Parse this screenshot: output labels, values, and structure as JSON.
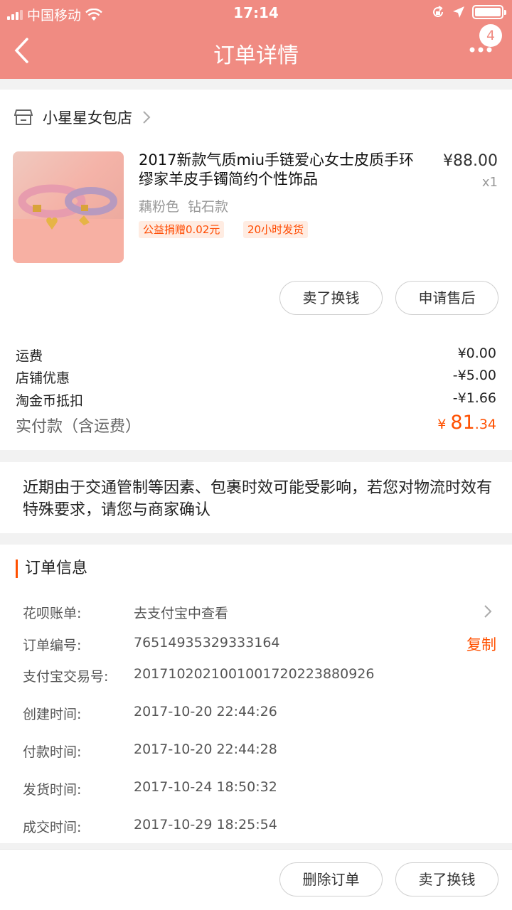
{
  "status_bar": {
    "carrier": "中国移动",
    "time": "17:14"
  },
  "nav": {
    "title": "订单详情",
    "badge_count": "4"
  },
  "shop": {
    "name": "小星星女包店"
  },
  "product": {
    "title": "2017新款气质miu手链爱心女士皮质手环 缪家羊皮手镯简约个性饰品",
    "price": "¥88.00",
    "quantity": "x1",
    "sku": "藕粉色 钻石款",
    "tags": [
      "公益捐赠0.02元",
      "20小时发货"
    ],
    "actions": [
      "卖了换钱",
      "申请售后"
    ]
  },
  "fees": [
    {
      "label": "运费",
      "value": "¥0.00"
    },
    {
      "label": "店铺优惠",
      "value": "-¥5.00"
    },
    {
      "label": "淘金币抵扣",
      "value": "-¥1.66"
    }
  ],
  "total": {
    "label": "实付款（含运费）",
    "currency": "¥",
    "integer": "81",
    "decimal": ".34"
  },
  "notice": "近期由于交通管制等因素、包裹时效可能受影响，若您对物流时效有特殊要求，请您与商家确认",
  "order_info": {
    "title": "订单信息",
    "huabei": {
      "label": "花呗账单:",
      "value": "去支付宝中查看"
    },
    "order_no": {
      "label": "订单编号:",
      "value": "76514935329333164",
      "action": "复制"
    },
    "alipay_no": {
      "label": "支付宝交易号:",
      "value": "2017102021001001720223880926"
    },
    "times": [
      {
        "label": "创建时间:",
        "value": "2017-10-20 22:44:26"
      },
      {
        "label": "付款时间:",
        "value": "2017-10-20 22:44:28"
      },
      {
        "label": "发货时间:",
        "value": "2017-10-24 18:50:32"
      },
      {
        "label": "成交时间:",
        "value": "2017-10-29 18:25:54"
      }
    ]
  },
  "footer_actions": [
    "删除订单",
    "卖了换钱"
  ],
  "colors": {
    "header": "#f08b82",
    "accent": "#ff5000",
    "tag_bg": "#ffece2"
  }
}
